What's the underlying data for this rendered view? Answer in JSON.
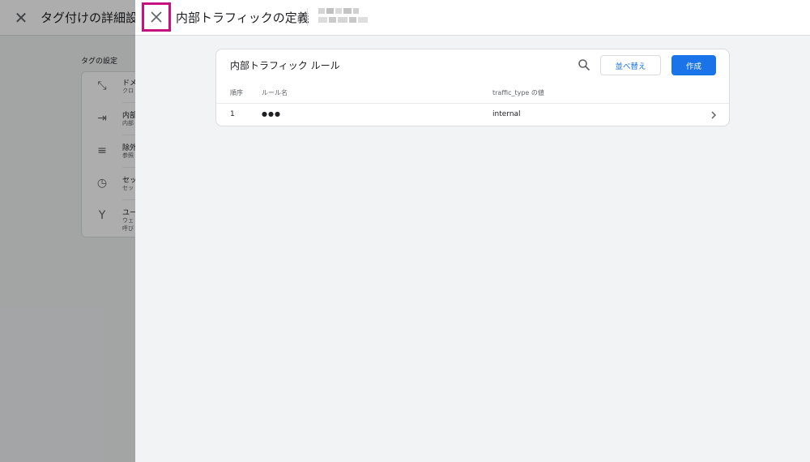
{
  "background": {
    "title": "タグ付けの詳細設定",
    "section_label": "タグの設定",
    "items": [
      {
        "line1": "ドメ",
        "line2": "クロ",
        "line3": ""
      },
      {
        "line1": "内部",
        "line2": "内部",
        "line3": ""
      },
      {
        "line1": "除外",
        "line2": "参照",
        "line3": ""
      },
      {
        "line1": "セッ",
        "line2": "セッ",
        "line3": ""
      },
      {
        "line1": "ユー",
        "line2": "ウェ",
        "line3": "呼び"
      }
    ]
  },
  "panel": {
    "title": "内部トラフィックの定義"
  },
  "rules_card": {
    "title": "内部トラフィック ルール",
    "sort_label": "並べ替え",
    "create_label": "作成",
    "columns": [
      "順序",
      "ルール名",
      "traffic_type の値"
    ],
    "rows": [
      {
        "order": "1",
        "name": "●●●",
        "value": "internal"
      }
    ]
  },
  "colors": {
    "accent": "#1a73e8",
    "highlight": "#c8107f"
  }
}
